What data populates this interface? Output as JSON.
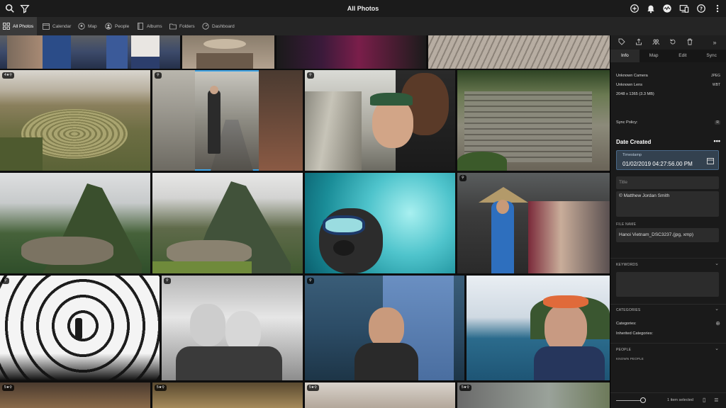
{
  "app": {
    "title": "All Photos"
  },
  "toolbar": {
    "left": [
      {
        "name": "search-icon",
        "glyph": "⌕"
      },
      {
        "name": "filter-icon",
        "glyph": "⛛"
      }
    ],
    "right": [
      {
        "name": "add-icon",
        "glyph": "+"
      },
      {
        "name": "notifications-icon",
        "glyph": "🔔"
      },
      {
        "name": "activity-icon",
        "glyph": "∿"
      },
      {
        "name": "devices-icon",
        "glyph": "▭"
      },
      {
        "name": "help-icon",
        "glyph": "?"
      },
      {
        "name": "more-icon",
        "glyph": "⋮"
      }
    ]
  },
  "nav": {
    "items": [
      {
        "label": "All Photos",
        "icon": "grid-icon"
      },
      {
        "label": "Calendar",
        "icon": "calendar-icon"
      },
      {
        "label": "Map",
        "icon": "map-pin-icon"
      },
      {
        "label": "People",
        "icon": "people-icon"
      },
      {
        "label": "Albums",
        "icon": "album-icon"
      },
      {
        "label": "Folders",
        "icon": "folder-icon"
      },
      {
        "label": "Dashboard",
        "icon": "dashboard-icon"
      }
    ]
  },
  "photos": {
    "badges": {
      "r1c1": "4★",
      "r1c2": "",
      "r1c3": "",
      "r2c4": "",
      "r3c1": "",
      "r3c2": "",
      "r3c3": "",
      "r4c1": "5★",
      "r4c2": "5★",
      "r4c3": "5★",
      "r4c4": "5★"
    }
  },
  "sidebar": {
    "tabs": [
      "Info",
      "Map",
      "Edit",
      "Sync"
    ],
    "camera": "Unknown Camera",
    "camera_tag": "JPEG",
    "lens": "Unknown Lens",
    "lens_tag": "WBT",
    "dimensions": "2048 x 1365 (3.3 MB)",
    "sync_policy_label": "Sync Policy:",
    "date_created_label": "Date Created",
    "timestamp_label": "Timestamp",
    "timestamp_value": "01/02/2019 04:27:56.00 PM",
    "title_placeholder": "Title",
    "caption_value": "© Matthew Jordan Smith",
    "file_name_label": "FILE NAME",
    "file_name_value": "Hanoi Vietnam_DSC3237.(jpg, xmp)",
    "keywords_label": "KEYWORDS",
    "categories_label": "CATEGORIES",
    "categories_field": "Categories:",
    "inherited_field": "Inherited Categories:",
    "people_label": "PEOPLE",
    "known_people": "KNOWN PEOPLE",
    "status": "1 item selected"
  }
}
